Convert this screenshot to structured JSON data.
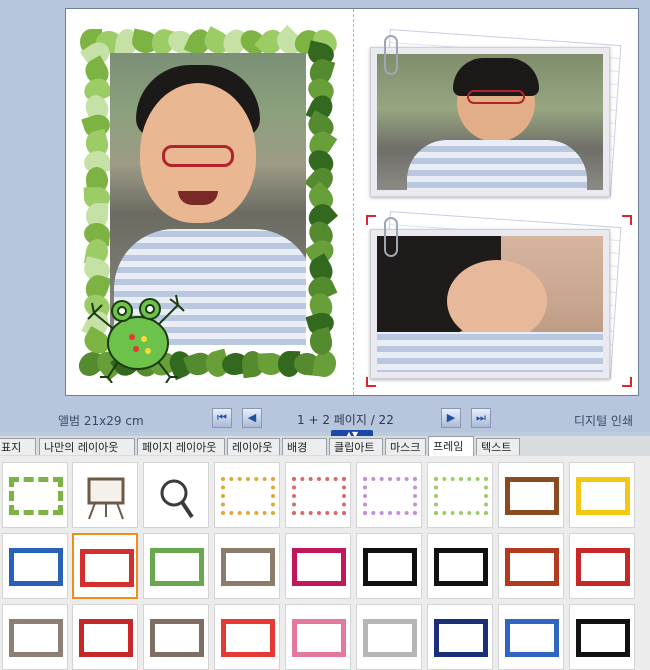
{
  "nav": {
    "album_size": "앨범 21x29 cm",
    "page_indicator": "1 + 2 페이지 / 22",
    "digital_label": "디지털 인쇄",
    "first_icon": "first-page-icon",
    "prev_icon": "prev-page-icon",
    "next_icon": "next-page-icon",
    "last_icon": "last-page-icon",
    "collapse_icon": "collapse-panel-icon"
  },
  "tabs": [
    {
      "label": "표지"
    },
    {
      "label": "나만의 레이아웃"
    },
    {
      "label": "페이지 레이아웃"
    },
    {
      "label": "레이아웃"
    },
    {
      "label": "배경"
    },
    {
      "label": "클립아트"
    },
    {
      "label": "마스크"
    },
    {
      "label": "프레임",
      "active": true
    },
    {
      "label": "텍스트"
    }
  ],
  "gallery": {
    "selected_index": 10,
    "items": [
      {
        "icon": "leaf-frame-icon",
        "color": "#7cb342"
      },
      {
        "icon": "easel-frame-icon",
        "color": "#6d5a47"
      },
      {
        "icon": "magnifier-frame-icon",
        "color": "#3a3a3a"
      },
      {
        "icon": "dotted-colorful-frame-icon",
        "color": "#e0a83c"
      },
      {
        "icon": "dotted-red-frame-icon",
        "color": "#d86a6a"
      },
      {
        "icon": "dotted-multi-frame-icon",
        "color": "#c78ed8"
      },
      {
        "icon": "dotted-green-frame-icon",
        "color": "#9ccc65"
      },
      {
        "icon": "wood-frame-icon",
        "color": "#8a4b20"
      },
      {
        "icon": "yellow-frame-icon",
        "color": "#f2c811"
      },
      {
        "icon": "blue-frame-icon",
        "color": "#2862b8"
      },
      {
        "icon": "red-frame-icon",
        "color": "#d32f2f"
      },
      {
        "icon": "green-frame-icon",
        "color": "#6aa84f"
      },
      {
        "icon": "brown-flower-frame-icon",
        "color": "#8d7b6b"
      },
      {
        "icon": "pink-stripe-frame-icon",
        "color": "#c2185b"
      },
      {
        "icon": "black-piano-frame-icon",
        "color": "#111111"
      },
      {
        "icon": "black-ornate-frame-icon",
        "color": "#111111"
      },
      {
        "icon": "red-cat-frame-icon",
        "color": "#b23a1e"
      },
      {
        "icon": "red-floral-frame-icon",
        "color": "#c62828"
      },
      {
        "icon": "taupe-frame-icon",
        "color": "#8d7f74"
      },
      {
        "icon": "red-lace-frame-icon",
        "color": "#c62828"
      },
      {
        "icon": "brown-corner-frame-icon",
        "color": "#7e6e63"
      },
      {
        "icon": "red-cartoon-frame-icon",
        "color": "#e53935"
      },
      {
        "icon": "pink-frame-icon",
        "color": "#e5799c"
      },
      {
        "icon": "gray-lace-frame-icon",
        "color": "#b5b5b5"
      },
      {
        "icon": "navy-star-frame-icon",
        "color": "#1a2f77"
      },
      {
        "icon": "blue-scroll-frame-icon",
        "color": "#2e66c0"
      },
      {
        "icon": "black-city-frame-icon",
        "color": "#111111"
      }
    ]
  },
  "colors": {
    "workspace_bg": "#b7c6dc",
    "selection_accent": "#f08d1e",
    "crop_marks": "#e0262d",
    "nav_accent": "#1c47a6"
  }
}
